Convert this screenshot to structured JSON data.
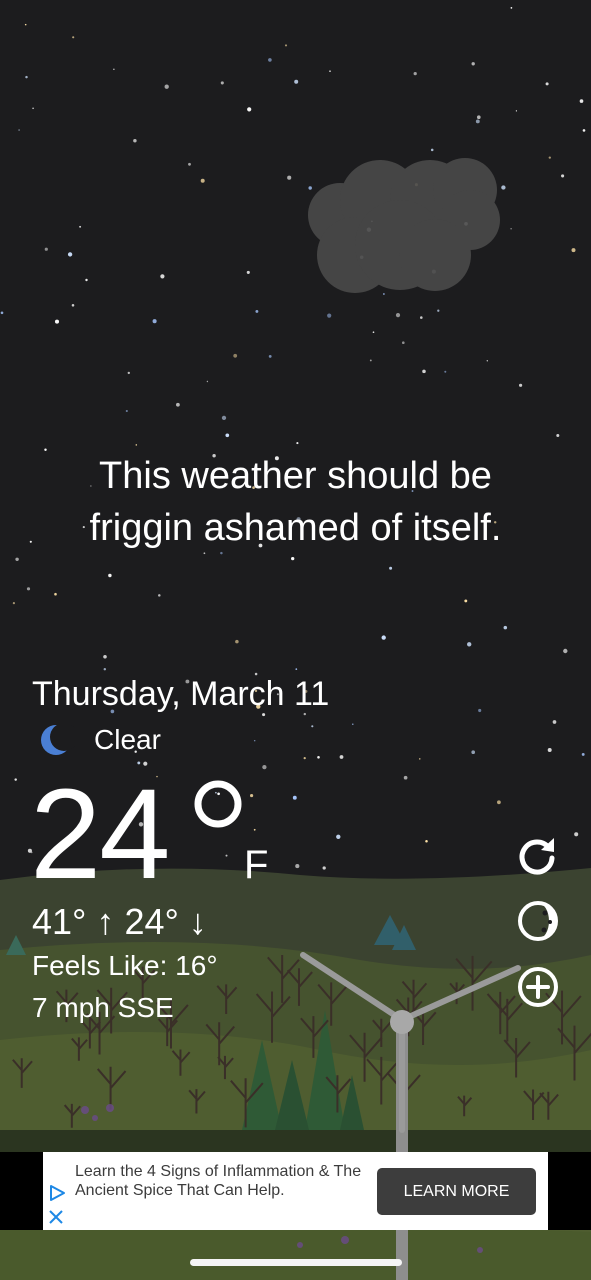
{
  "tagline": {
    "line1": "This weather should be",
    "line2": "friggin ashamed of itself."
  },
  "weather": {
    "date": "Thursday, March 11",
    "condition": "Clear",
    "condition_icon": "crescent-moon-icon",
    "temperature": "24",
    "unit": "F",
    "high": "41°",
    "low": "24°",
    "hilo_text": "41° ↑  24° ↓",
    "feels_like": "Feels Like: 16°",
    "wind": "7 mph SSE"
  },
  "side_buttons": [
    {
      "icon": "refresh-icon"
    },
    {
      "icon": "moon-phase-icon"
    },
    {
      "icon": "add-location-icon"
    }
  ],
  "ad": {
    "text": "Learn the 4 Signs of Inflammation & The Ancient Spice That Can Help.",
    "cta": "LEARN MORE"
  },
  "colors": {
    "sky": "#1c1c1e",
    "hills": "#3f4a2c",
    "moon_icon": "#4a7fd4",
    "ad_button": "#3d3d3d",
    "adchoices": "#1e88e5"
  }
}
